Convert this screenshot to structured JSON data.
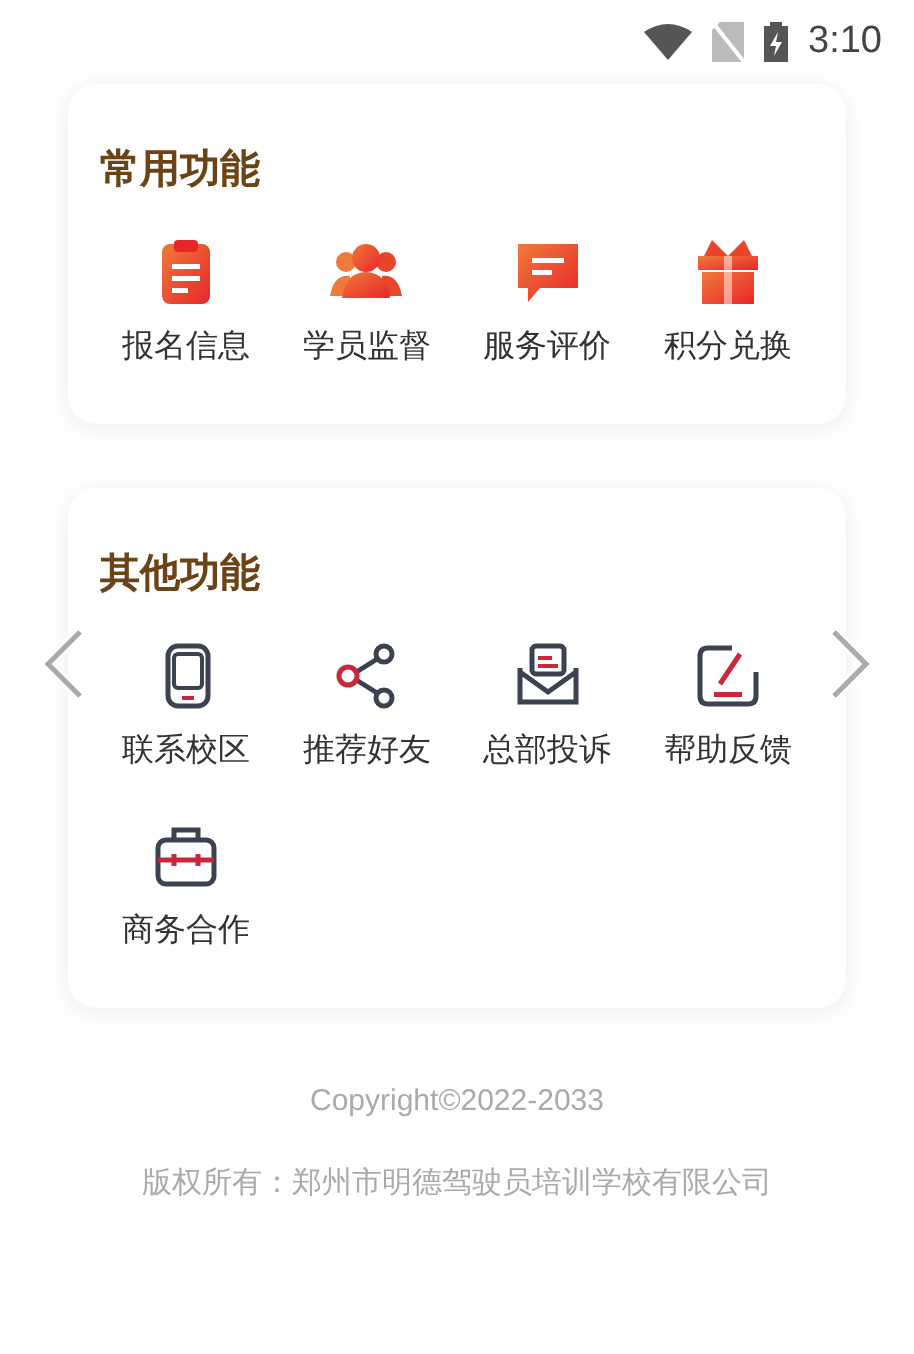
{
  "status_bar": {
    "time": "3:10"
  },
  "sections": [
    {
      "title": "常用功能",
      "items": [
        {
          "label": "报名信息"
        },
        {
          "label": "学员监督"
        },
        {
          "label": "服务评价"
        },
        {
          "label": "积分兑换"
        }
      ]
    },
    {
      "title": "其他功能",
      "items": [
        {
          "label": "联系校区"
        },
        {
          "label": "推荐好友"
        },
        {
          "label": "总部投诉"
        },
        {
          "label": "帮助反馈"
        },
        {
          "label": "商务合作"
        }
      ]
    }
  ],
  "footer": {
    "copyright": "Copyright©2022-2033",
    "rights": "版权所有：郑州市明德驾驶员培训学校有限公司"
  }
}
